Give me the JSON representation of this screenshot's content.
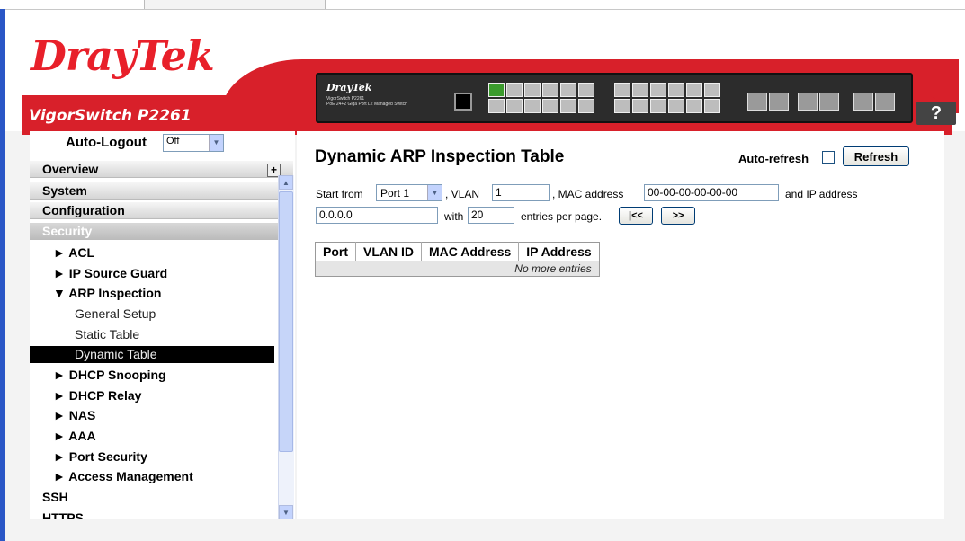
{
  "header": {
    "logo": "DrayTek",
    "model": "VigorSwitch P2261",
    "device_brand": "DrayTek",
    "device_model": "VigorSwitch P2261",
    "device_desc": "PoE 24+2 Giga Port L2 Managed Switch",
    "help": "?"
  },
  "sidebar": {
    "autologout_label": "Auto-Logout",
    "autologout_value": "Off",
    "overview": "Overview",
    "system": "System",
    "configuration": "Configuration",
    "security": "Security",
    "items": [
      {
        "label": "► ACL"
      },
      {
        "label": "► IP Source Guard"
      },
      {
        "label": "▼ ARP Inspection"
      },
      {
        "label": "General Setup"
      },
      {
        "label": "Static Table"
      },
      {
        "label": "Dynamic Table"
      },
      {
        "label": "► DHCP Snooping"
      },
      {
        "label": "► DHCP Relay"
      },
      {
        "label": "► NAS"
      },
      {
        "label": "► AAA"
      },
      {
        "label": "► Port Security"
      },
      {
        "label": "► Access Management"
      },
      {
        "label": "SSH"
      },
      {
        "label": "HTTPS"
      }
    ]
  },
  "main": {
    "title": "Dynamic ARP Inspection Table",
    "autorefresh_label": "Auto-refresh",
    "refresh_label": "Refresh",
    "start_from_label": "Start from",
    "port_value": "Port 1",
    "vlan_label": ", VLAN",
    "vlan_value": "1",
    "mac_label": ", MAC address",
    "mac_value": "00-00-00-00-00-00",
    "ip_label": "and IP address",
    "ip_value": "0.0.0.0",
    "with_label": "with",
    "entries_value": "20",
    "entries_label": "entries per page.",
    "first_label": "|<<",
    "next_label": ">>",
    "table": {
      "columns": [
        "Port",
        "VLAN ID",
        "MAC Address",
        "IP Address"
      ],
      "empty": "No more entries"
    }
  }
}
